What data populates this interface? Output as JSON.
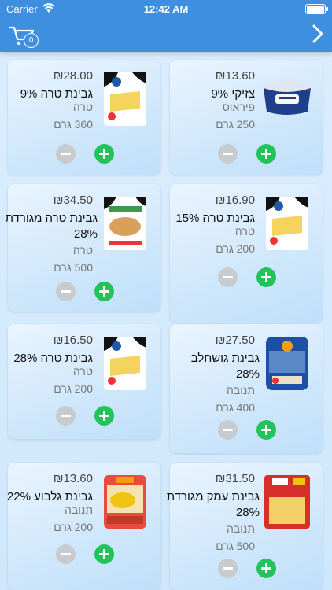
{
  "status": {
    "carrier": "Carrier",
    "time": "12:42 AM"
  },
  "nav": {
    "cart_count": "0"
  },
  "products": [
    {
      "price": "₪13.60",
      "name": "צזיקי 9%",
      "brand": "פיראוס",
      "weight": "250 גרם",
      "image": "tzatziki-tub"
    },
    {
      "price": "₪28.00",
      "name": "גבינת טרה 9%",
      "brand": "טרה",
      "weight": "360 גרם",
      "image": "tara-cheese-pack"
    },
    {
      "price": "₪16.90",
      "name": "גבינת טרה 15%",
      "brand": "טרה",
      "weight": "200 גרם",
      "image": "tara-cheese-pack"
    },
    {
      "price": "₪34.50",
      "name": "גבינת טרה מגורדת 28%",
      "brand": "טרה",
      "weight": "500 גרם",
      "image": "tara-grated-pack"
    },
    {
      "price": "₪27.50",
      "name": "גבינת גושחלב 28%",
      "brand": "תנובה",
      "weight": "400 גרם",
      "image": "gush-halav-pack"
    },
    {
      "price": "₪16.50",
      "name": "גבינת טרה 28%",
      "brand": "טרה",
      "weight": "200 גרם",
      "image": "tara-cheese-pack"
    },
    {
      "price": "₪31.50",
      "name": "גבינת עמק מגורדת 28%",
      "brand": "תנובה",
      "weight": "500 גרם",
      "image": "emek-grated-bag"
    },
    {
      "price": "₪13.60",
      "name": "גבינת גלבוע 22%",
      "brand": "תנובה",
      "weight": "200 גרם",
      "image": "gilboa-cheese-pack"
    }
  ]
}
